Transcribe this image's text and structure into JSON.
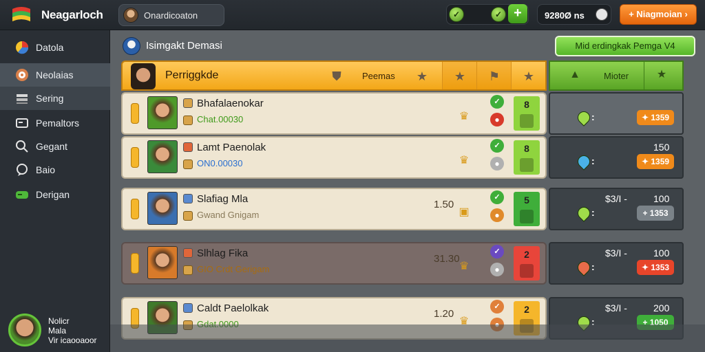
{
  "app": {
    "title": "Neagarloch"
  },
  "player": {
    "name": "Onardicoaton"
  },
  "resources": {
    "icon1": "leaf-coin",
    "icon2": "gem"
  },
  "coins": "9280Ø ns",
  "top_button": "+ Niagmoian ›",
  "sidebar": {
    "items": [
      {
        "label": "Datola"
      },
      {
        "label": "Neolaias"
      },
      {
        "label": "Sering"
      },
      {
        "label": "Pemaltors"
      },
      {
        "label": "Gegant"
      },
      {
        "label": "Baio"
      },
      {
        "label": "Derigan"
      }
    ],
    "profile": {
      "line1": "Nolicr",
      "line2": "Mala",
      "line3": "Vir icaooaoor"
    }
  },
  "section": {
    "title": "Isimgakt Demasi"
  },
  "action_button": "Mid erdingkak Pemga V4",
  "table": {
    "header_title": "Perriggkde",
    "header_label": "Peemas",
    "right_label": "Mioter"
  },
  "rows": [
    {
      "name": "Bhafalaenokar",
      "sub": "Chat.00030",
      "sub_color": "#3f9a1a",
      "score": "",
      "tile_num": "8",
      "tile_color": "#8fd43e",
      "right_price": "",
      "right_val": "",
      "pill": "✦ 1359",
      "pill_color": "#f08a1a",
      "shield_color": "#9fdc4a",
      "dark": false
    },
    {
      "name": "Lamt Paenolak",
      "sub": "ON0.00030",
      "sub_color": "#2a6fd0",
      "score": "",
      "tile_num": "8",
      "tile_color": "#8fd43e",
      "right_price": "",
      "right_val": "150",
      "pill": "✦ 1359",
      "pill_color": "#f08a1a",
      "shield_color": "#4ab2e6",
      "dark": false
    },
    {
      "name": "Slafiag Mla",
      "sub": "Gwand Gnigam",
      "sub_color": "#8a7a5a",
      "score": "1.50",
      "tile_num": "5",
      "tile_color": "#3fae3a",
      "right_price": "$3/I  -",
      "right_val": "100",
      "pill": "+ 1353",
      "pill_color": "#7a8288",
      "shield_color": "#9fdc4a",
      "dark": false
    },
    {
      "name": "Slhlag Fika",
      "sub": "GIO Crdt Gerigam",
      "sub_color": "#a86c10",
      "score": "31.30",
      "tile_num": "2",
      "tile_color": "#e8453a",
      "right_price": "$3/I  -",
      "right_val": "100",
      "pill": "✦ 1353",
      "pill_color": "#e8452a",
      "shield_color": "#e86c4a",
      "dark": true
    },
    {
      "name": "Caldt Paelolkak",
      "sub": "Gdat.0000",
      "sub_color": "#3f9a1a",
      "score": "1.20",
      "tile_num": "2",
      "tile_color": "#f5b62b",
      "right_price": "$3/I  -",
      "right_val": "200",
      "pill": "+ 1050",
      "pill_color": "#3fae3a",
      "shield_color": "#9fdc4a",
      "dark": false
    }
  ]
}
